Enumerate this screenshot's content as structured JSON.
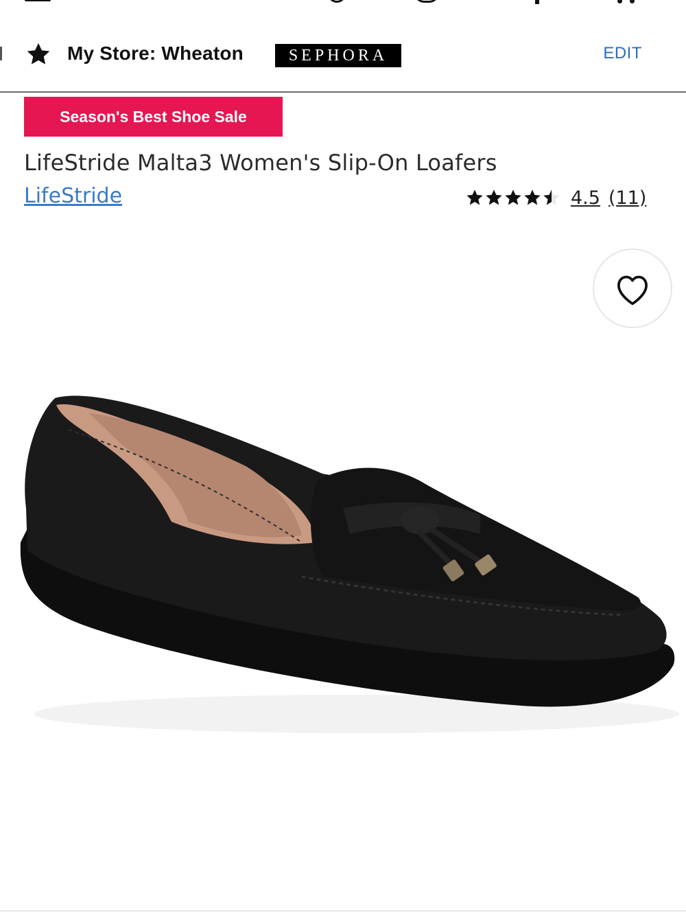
{
  "store": {
    "label": "My Store: Wheaton",
    "retailer_partner": "SEPHORA",
    "edit_label": "EDIT"
  },
  "promo": {
    "badge_text": "Season's Best Shoe Sale",
    "badge_color": "#e51652"
  },
  "product": {
    "title": "LifeStride Malta3 Women's Slip-On Loafers",
    "brand": "LifeStride",
    "rating_value": 4.5,
    "rating_max": 5,
    "rating_text": "4.5",
    "review_count_text": "(11)",
    "image_icon": "black-loafer-image"
  },
  "colors": {
    "link": "#3b7ac8",
    "edit": "#2a6ebb"
  }
}
